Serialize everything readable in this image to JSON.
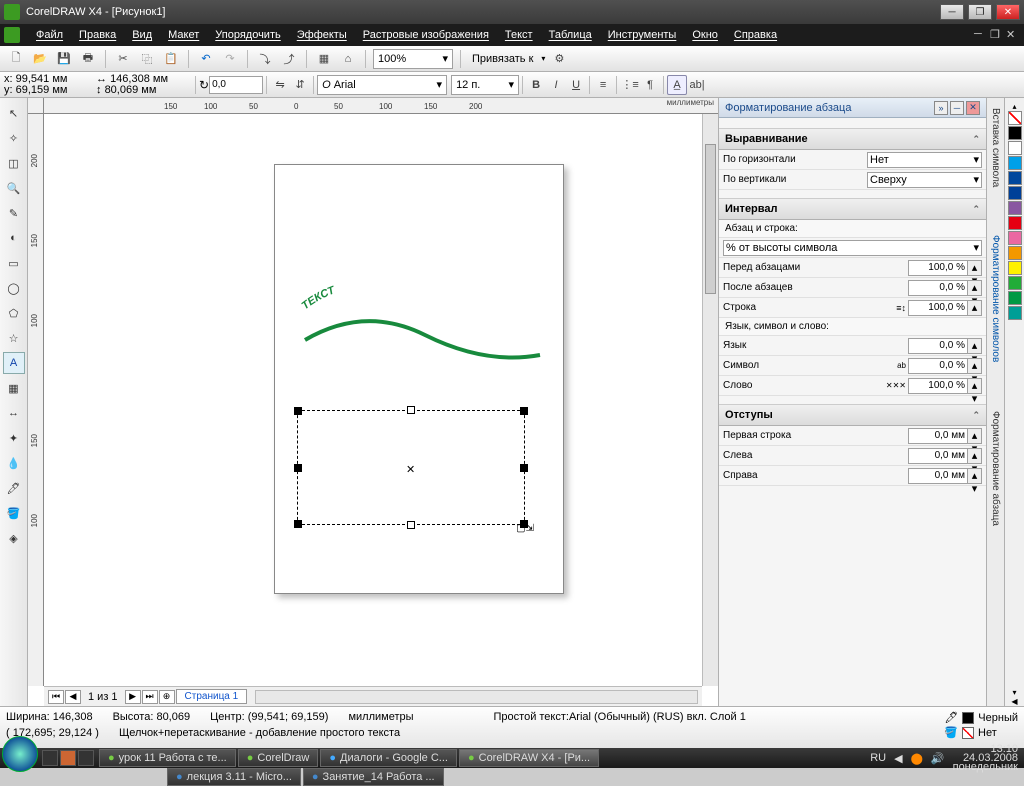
{
  "title": "CorelDRAW X4 - [Рисунок1]",
  "menu": [
    "Файл",
    "Правка",
    "Вид",
    "Макет",
    "Упорядочить",
    "Эффекты",
    "Растровые изображения",
    "Текст",
    "Таблица",
    "Инструменты",
    "Окно",
    "Справка"
  ],
  "zoom": "100%",
  "snap_label": "Привязать к",
  "coords": {
    "x_label": "x:",
    "x": "99,541 мм",
    "y_label": "y:",
    "y": "69,159 мм",
    "w": "146,308 мм",
    "h": "80,069 мм"
  },
  "rotation": "0,0",
  "font": "Arial",
  "font_size": "12 п.",
  "ruler_unit": "миллиметры",
  "pages": {
    "label": "1 из 1",
    "tab": "Страница 1"
  },
  "docker": {
    "title": "Форматирование абзаца",
    "sections": {
      "align": {
        "head": "Выравнивание",
        "horiz_label": "По горизонтали",
        "horiz_val": "Нет",
        "vert_label": "По вертикали",
        "vert_val": "Сверху"
      },
      "spacing": {
        "head": "Интервал",
        "sub": "Абзац и строка:",
        "unit_combo": "% от высоты символа",
        "before_label": "Перед абзацами",
        "before": "100,0 %",
        "after_label": "После абзацев",
        "after": "0,0 %",
        "line_label": "Строка",
        "line": "100,0 %",
        "sub2": "Язык, символ и слово:",
        "lang_label": "Язык",
        "lang": "0,0 %",
        "char_label": "Символ",
        "char": "0,0 %",
        "word_label": "Слово",
        "word": "100,0 %"
      },
      "indent": {
        "head": "Отступы",
        "first_label": "Первая строка",
        "first": "0,0 мм",
        "left_label": "Слева",
        "left": "0,0 мм",
        "right_label": "Справа",
        "right": "0,0 мм"
      }
    }
  },
  "vtabs": [
    "Вставка символа",
    "Форматирование символов",
    "Форматирование абзаца"
  ],
  "canvas_text": "ТЕКСТ",
  "status": {
    "line1_w": "Ширина: 146,308",
    "line1_h": "Высота: 80,069",
    "line1_c": "Центр: (99,541; 69,159)",
    "line1_u": "миллиметры",
    "text_info": "Простой текст:Arial (Обычный) (RUS) вкл. Слой 1",
    "cursor": "( 172,695; 29,124 )",
    "hint": "Щелчок+перетаскивание - добавление простого текста",
    "outline_label": "Черный",
    "fill_label": "Нет"
  },
  "palette_colors": [
    "#000000",
    "#ffffff",
    "#00a0e8",
    "#00479d",
    "#004098",
    "#8957a1",
    "#e60012",
    "#ea68a2",
    "#f39800",
    "#fff100",
    "#22ac38",
    "#009944",
    "#009e96"
  ],
  "taskbar": {
    "items": [
      "урок 11 Работа с те...",
      "CorelDraw",
      "Диалоги - Google C...",
      "CorelDRAW X4 - [Ри...",
      "лекция 3.11 - Micro...",
      "Занятие_14 Работа ..."
    ],
    "lang": "RU",
    "time": "13:10",
    "date": "24.03.2008",
    "day": "понедельник"
  },
  "ruler_h": [
    "150",
    "100",
    "50",
    "0",
    "50",
    "100",
    "150",
    "200"
  ],
  "ruler_v": [
    "200",
    "150",
    "100",
    "150",
    "100"
  ]
}
